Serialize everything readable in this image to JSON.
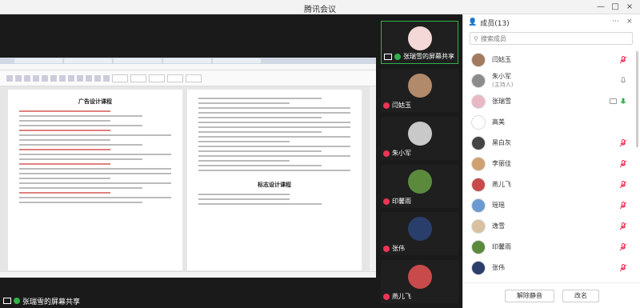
{
  "window": {
    "title": "腾讯会议",
    "minimize_icon": "—",
    "maximize_icon": "□",
    "close_icon": "×"
  },
  "share": {
    "presenter_label": "张瑞雪的屏幕共享"
  },
  "document": {
    "page1_title": "广告设计课程",
    "page2_title": "标志设计课程"
  },
  "thumbnails": [
    {
      "label": "张瑞雪的屏幕共享",
      "active": true,
      "color": "#f4d7d7"
    },
    {
      "label": "闫姑玉",
      "active": false,
      "color": "#b08a6a"
    },
    {
      "label": "朱小军",
      "active": false,
      "color": "#c9c9c9"
    },
    {
      "label": "印馨雨",
      "active": false,
      "color": "#5c8a3c"
    },
    {
      "label": "张伟",
      "active": false,
      "color": "#2a3e6c"
    },
    {
      "label": "燕儿飞",
      "active": false,
      "color": "#c84a4a"
    }
  ],
  "members_panel": {
    "title": "成员(13)",
    "search_placeholder": "搜索成员",
    "members": [
      {
        "name": "闫姑玉",
        "sub": "",
        "color": "#a27a5e",
        "mic": "muted"
      },
      {
        "name": "朱小军",
        "sub": "(主持人)",
        "color": "#8c8c8c",
        "mic": "off-gray"
      },
      {
        "name": "张瑞雪",
        "sub": "",
        "color": "#e8b9c4",
        "mic": "on"
      },
      {
        "name": "高美",
        "sub": "",
        "color": "#ffffff",
        "mic": "none"
      },
      {
        "name": "黑白灰",
        "sub": "",
        "color": "#444444",
        "mic": "muted"
      },
      {
        "name": "李丽佳",
        "sub": "",
        "color": "#d0a070",
        "mic": "muted"
      },
      {
        "name": "燕儿飞",
        "sub": "",
        "color": "#c84a4a",
        "mic": "muted"
      },
      {
        "name": "瑶瑶",
        "sub": "",
        "color": "#6a9ad0",
        "mic": "muted"
      },
      {
        "name": "逸雪",
        "sub": "",
        "color": "#d8c0a0",
        "mic": "muted"
      },
      {
        "name": "印馨雨",
        "sub": "",
        "color": "#5c8a3c",
        "mic": "muted"
      },
      {
        "name": "张伟",
        "sub": "",
        "color": "#2a3e6c",
        "mic": "muted"
      }
    ],
    "unmute_all_label": "解除静音",
    "rename_label": "改名"
  },
  "colors": {
    "accent_green": "#2fb24a",
    "muted_red": "#e35"
  }
}
